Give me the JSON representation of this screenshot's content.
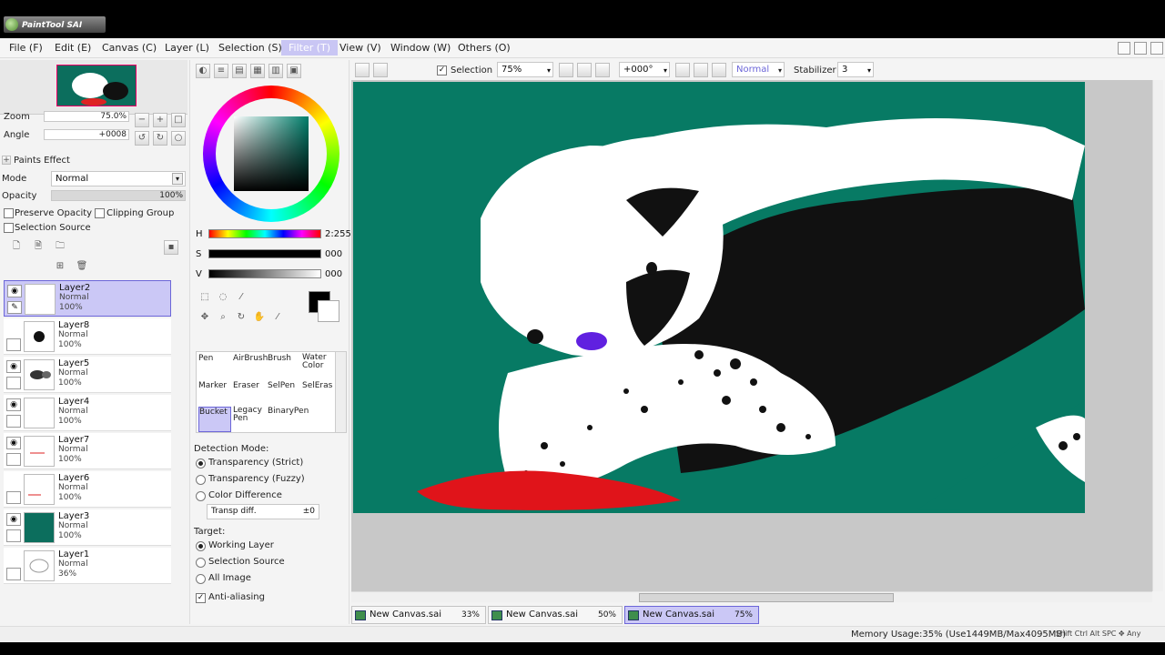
{
  "app": {
    "title": "PaintTool SAI"
  },
  "menu": [
    "File (F)",
    "Edit (E)",
    "Canvas (C)",
    "Layer (L)",
    "Selection (S)",
    "Filter (T)",
    "View (V)",
    "Window (W)",
    "Others (O)"
  ],
  "navigator": {
    "zoom_label": "Zoom",
    "zoom_value": "75.0%",
    "angle_label": "Angle",
    "angle_value": "+0008"
  },
  "layer_props": {
    "paints_effect": "Paints Effect",
    "mode_label": "Mode",
    "mode_value": "Normal",
    "opacity_label": "Opacity",
    "opacity_value": "100%",
    "preserve_opacity": "Preserve Opacity",
    "clipping_group": "Clipping Group",
    "selection_source": "Selection Source"
  },
  "layers": [
    {
      "name": "Layer2",
      "mode": "Normal",
      "opacity": "100%",
      "selected": true
    },
    {
      "name": "Layer8",
      "mode": "Normal",
      "opacity": "100%"
    },
    {
      "name": "Layer5",
      "mode": "Normal",
      "opacity": "100%"
    },
    {
      "name": "Layer4",
      "mode": "Normal",
      "opacity": "100%"
    },
    {
      "name": "Layer7",
      "mode": "Normal",
      "opacity": "100%"
    },
    {
      "name": "Layer6",
      "mode": "Normal",
      "opacity": "100%"
    },
    {
      "name": "Layer3",
      "mode": "Normal",
      "opacity": "100%"
    },
    {
      "name": "Layer1",
      "mode": "Normal",
      "opacity": "36%"
    }
  ],
  "color": {
    "h_label": "H",
    "h_value": "2:255",
    "s_label": "S",
    "s_value": "000",
    "v_label": "V",
    "v_value": "000",
    "accent": "#007e6b"
  },
  "tools": [
    "Pen",
    "AirBrush",
    "Brush",
    "Water Color",
    "Marker",
    "Eraser",
    "SelPen",
    "SelEras",
    "Bucket",
    "Legacy Pen",
    "BinaryPen"
  ],
  "bucket_options": {
    "detection_label": "Detection Mode:",
    "detection": [
      "Transparency (Strict)",
      "Transparency (Fuzzy)",
      "Color Difference"
    ],
    "transp_diff_label": "Transp diff.",
    "transp_diff_value": "±0",
    "target_label": "Target:",
    "target": [
      "Working Layer",
      "Selection Source",
      "All Image"
    ],
    "antialias": "Anti-aliasing"
  },
  "canvas_toolbar": {
    "selection_label": "Selection",
    "zoom": "75%",
    "angle": "+000°",
    "blend": "Normal",
    "stabilizer_label": "Stabilizer",
    "stabilizer_value": "3"
  },
  "tabs": [
    {
      "name": "New Canvas.sai",
      "pct": "33%"
    },
    {
      "name": "New Canvas.sai",
      "pct": "50%"
    },
    {
      "name": "New Canvas.sai",
      "pct": "75%",
      "active": true
    }
  ],
  "status": {
    "memory": "Memory Usage:35% (Use1449MB/Max4095MB)",
    "keys": "Shift Ctrl Alt SPC ✥ Any"
  }
}
